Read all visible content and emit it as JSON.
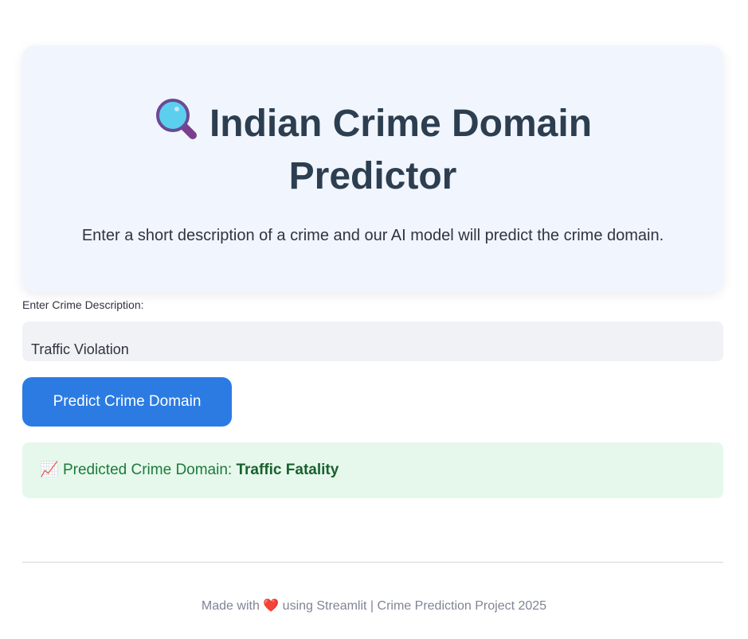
{
  "hero": {
    "title": "Indian Crime Domain Predictor",
    "subtitle": "Enter a short description of a crime and our AI model will predict the crime domain.",
    "icon": "magnifying-glass-icon"
  },
  "form": {
    "label": "Enter Crime Description:",
    "value": "Traffic Violation",
    "button": "Predict Crime Domain"
  },
  "result": {
    "icon": "chart-increasing-icon",
    "emoji": "📈",
    "prefix": "Predicted Crime Domain: ",
    "value": "Traffic Fatality"
  },
  "footer": {
    "before": "Made with ",
    "heart": "❤️",
    "after": " using Streamlit | Crime Prediction Project 2025"
  }
}
